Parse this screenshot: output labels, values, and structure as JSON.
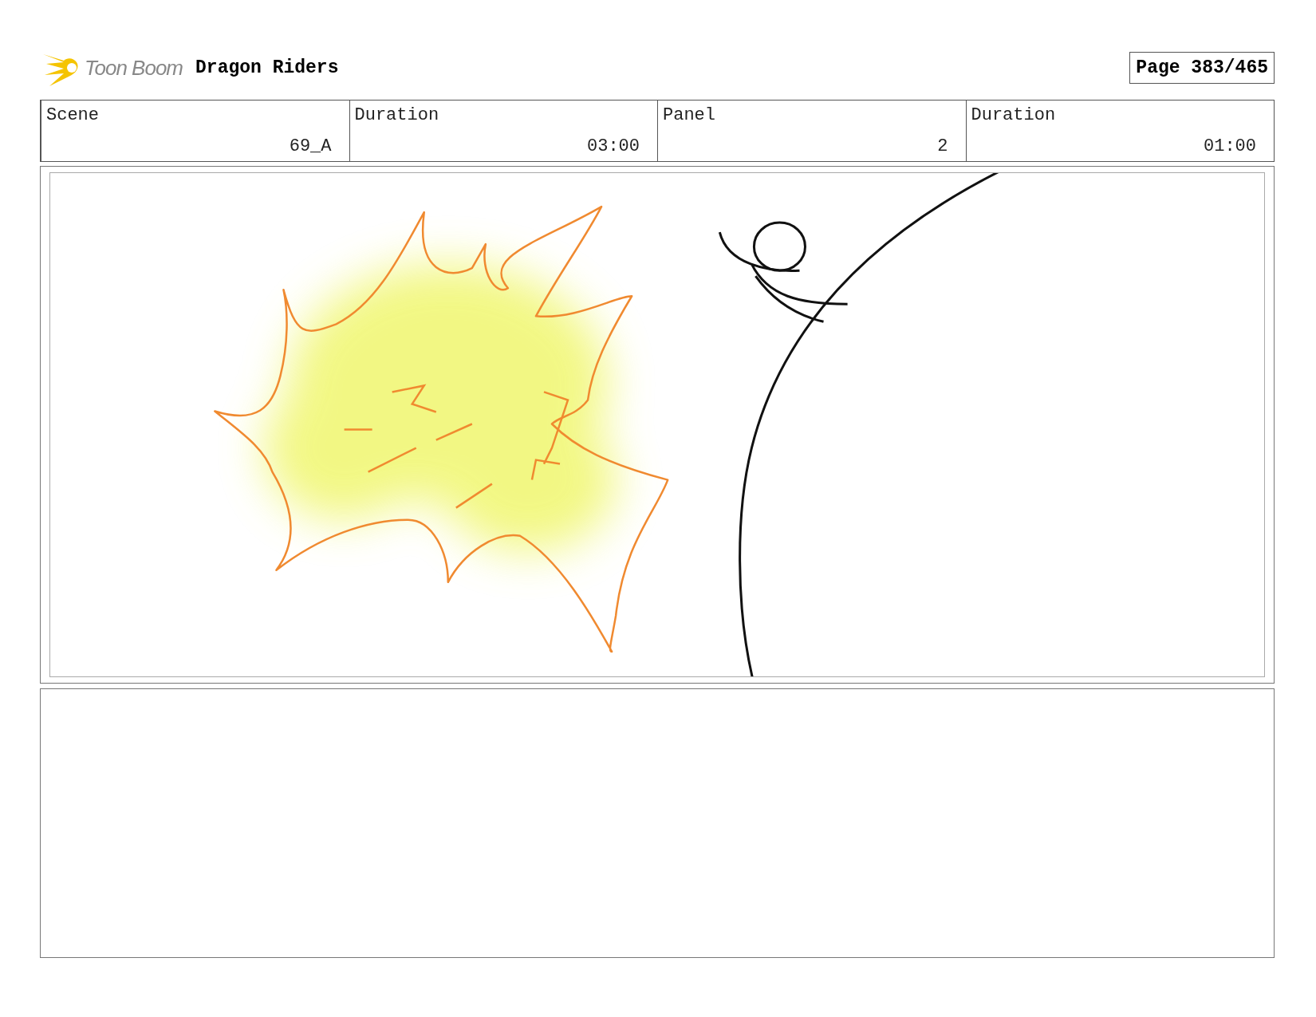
{
  "header": {
    "logo_text": "Toon Boom",
    "title": "Dragon Riders",
    "page": "Page 383/465"
  },
  "fields": [
    {
      "label": "Scene",
      "value": "69_A"
    },
    {
      "label": "Duration",
      "value": "03:00"
    },
    {
      "label": "Panel",
      "value": "2"
    },
    {
      "label": "Duration",
      "value": "01:00"
    }
  ]
}
